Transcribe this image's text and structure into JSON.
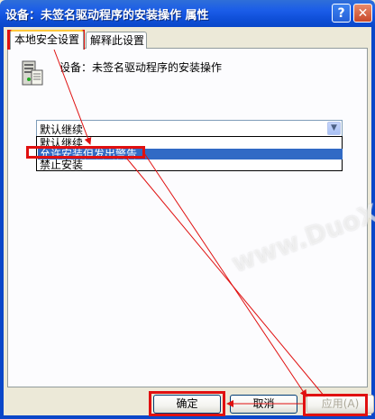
{
  "window": {
    "title": "设备：未签名驱动程序的安装操作 属性",
    "help_label": "?",
    "close_label": "✕"
  },
  "tabs": [
    {
      "label": "本地安全设置",
      "active": true
    },
    {
      "label": "解释此设置",
      "active": false
    }
  ],
  "setting": {
    "icon": "policy-device-icon",
    "description": "设备：未签名驱动程序的安装操作"
  },
  "select": {
    "value": "默认继续",
    "arrow_icon": "chevron-down-icon",
    "options": [
      "默认继续",
      "允许安装但发出警告",
      "禁止安装"
    ],
    "selected_option": "允许安装但发出警告"
  },
  "buttons": {
    "ok": "确定",
    "cancel": "取消",
    "apply": "应用(A)"
  },
  "watermark": "www.DuoXie.com",
  "colors": {
    "annotation": "#e01010",
    "selection": "#316ac5",
    "titlebar": "#0a47c9"
  }
}
